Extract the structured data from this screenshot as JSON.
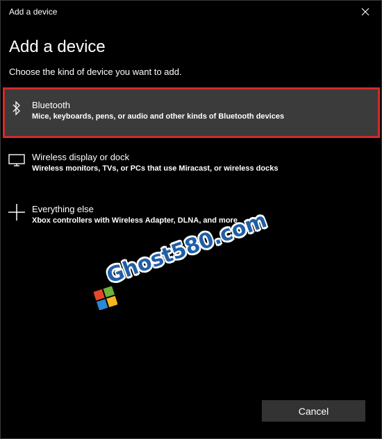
{
  "window": {
    "title": "Add a device",
    "heading": "Add a device",
    "subheading": "Choose the kind of device you want to add."
  },
  "options": [
    {
      "name": "Bluetooth",
      "description": "Mice, keyboards, pens, or audio and other kinds of Bluetooth devices",
      "icon": "bluetooth-icon",
      "selected": true
    },
    {
      "name": "Wireless display or dock",
      "description": "Wireless monitors, TVs, or PCs that use Miracast, or wireless docks",
      "icon": "monitor-icon",
      "selected": false
    },
    {
      "name": "Everything else",
      "description": "Xbox controllers with Wireless Adapter, DLNA, and more",
      "icon": "plus-icon",
      "selected": false
    }
  ],
  "footer": {
    "cancel_label": "Cancel"
  },
  "watermark": {
    "text": "Ghost580.com"
  },
  "colors": {
    "background": "#000000",
    "selected_background": "#3b3b3b",
    "highlight_border": "#d42a2a",
    "button_background": "#333333",
    "text": "#ffffff"
  }
}
